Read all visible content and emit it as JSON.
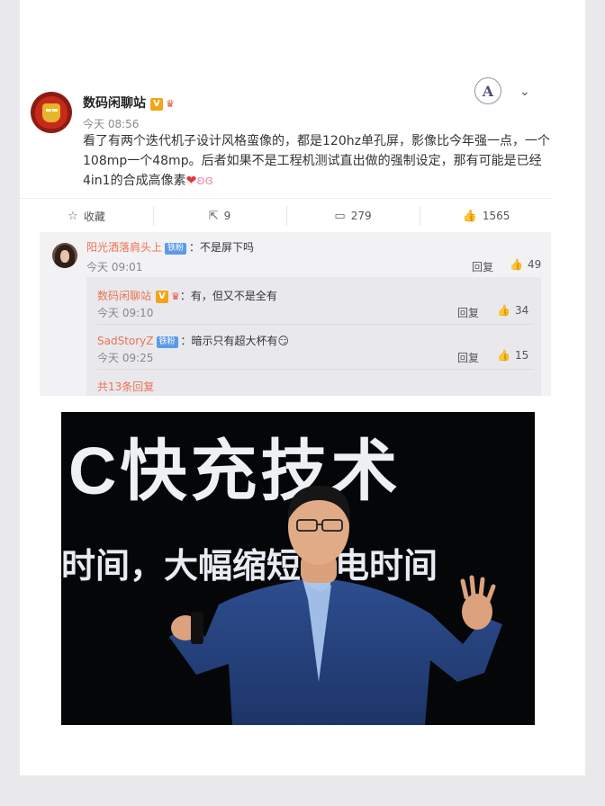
{
  "post": {
    "author": "数码闲聊站",
    "time": "今天 08:56",
    "text": "看了有两个迭代机子设计风格蛮像的，都是120hz单孔屏，影像比今年强一点，一个108mp一个48mp。后者如果不是工程机测试直出做的强制设定，那有可能是已经4in1的合成高像素",
    "verified_badge": "V",
    "right_logo_letter": "A"
  },
  "actions": {
    "favorite": "收藏",
    "repost": "9",
    "comment": "279",
    "like": "1565"
  },
  "comments": {
    "main": {
      "name": "阳光洒落肩头上",
      "badge": "铁粉",
      "text": "：不是屏下吗",
      "time": "今天 09:01",
      "reply": "回复",
      "likes": "49"
    },
    "replies": [
      {
        "name": "数码闲聊站",
        "text": "：有，但又不是全有",
        "time": "今天 09:10",
        "reply": "回复",
        "likes": "34"
      },
      {
        "name": "SadStoryZ",
        "badge": "铁粉",
        "text": "：暗示只有超大杯有",
        "time": "今天 09:25",
        "reply": "回复",
        "likes": "15"
      }
    ],
    "more": "共13条回复"
  },
  "photo": {
    "line1": "C快充技术",
    "line2": "时间，大幅缩短充电时间"
  }
}
